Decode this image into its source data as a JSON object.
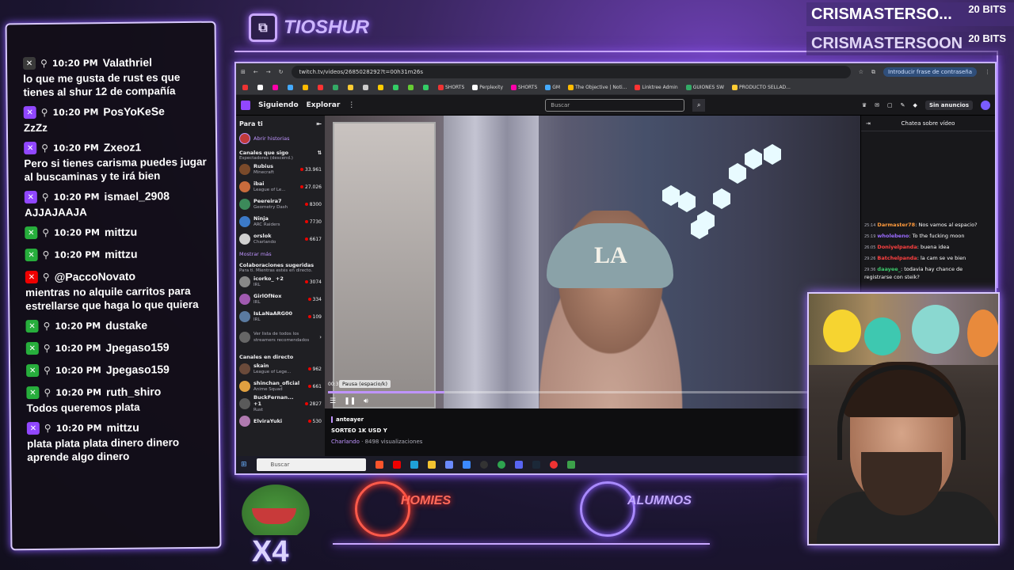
{
  "overlay_chat": {
    "messages": [
      {
        "time": "10:20 PM",
        "user": "Valathriel",
        "text": "lo que me gusta de rust es que tienes al shur 12 de compañía",
        "badge_color": "#3a3a3a",
        "name_color": "#ffffff"
      },
      {
        "time": "10:20 PM",
        "user": "PosYoKeSe",
        "text": "ZzZz",
        "badge_color": "#9147ff",
        "name_color": "#ffffff"
      },
      {
        "time": "10:20 PM",
        "user": "Zxeoz1",
        "text": "Pero si tienes carisma puedes jugar al buscaminas y te irá bien",
        "badge_color": "#9147ff",
        "name_color": "#ffffff"
      },
      {
        "time": "10:20 PM",
        "user": "ismael_2908",
        "text": "AJJAJAAJA",
        "badge_color": "#9147ff",
        "name_color": "#ffffff"
      },
      {
        "time": "10:20 PM",
        "user": "mittzu",
        "text": "",
        "badge_color": "#27ae3c",
        "name_color": "#ffffff"
      },
      {
        "time": "10:20 PM",
        "user": "mittzu",
        "text": "",
        "badge_color": "#27ae3c",
        "name_color": "#ffffff"
      },
      {
        "time": "",
        "user": "@PaccoNovato",
        "text": "mientras no alquile carritos para estrellarse que haga lo que quiera",
        "badge_color": "#e00",
        "name_color": "#ffffff"
      },
      {
        "time": "10:20 PM",
        "user": "dustake",
        "text": "",
        "badge_color": "#27ae3c",
        "name_color": "#ffffff"
      },
      {
        "time": "10:20 PM",
        "user": "Jpegaso159",
        "text": "",
        "badge_color": "#27ae3c",
        "name_color": "#ffffff"
      },
      {
        "time": "10:20 PM",
        "user": "Jpegaso159",
        "text": "",
        "badge_color": "#27ae3c",
        "name_color": "#ffffff"
      },
      {
        "time": "10:20 PM",
        "user": "ruth_shiro",
        "text": "Todos queremos plata",
        "badge_color": "#27ae3c",
        "name_color": "#ffffff"
      },
      {
        "time": "10:20 PM",
        "user": "mittzu",
        "text": "plata plata plata dinero dinero aprende algo dinero",
        "badge_color": "#9147ff",
        "name_color": "#ffffff"
      }
    ]
  },
  "bits": [
    {
      "name": "CRISMASTERSO...",
      "amount": "20 BITS"
    },
    {
      "name": "CRISMASTERSOON",
      "amount": "20 BITS"
    }
  ],
  "logo": {
    "text": "TIOSHUR"
  },
  "browser": {
    "url": "twitch.tv/videos/2685028292?t=00h31m26s",
    "password_chip": "Introducir frase de contraseña",
    "bookmarks": [
      "SHORTS",
      "Perplexity",
      "SHORTS",
      "GM",
      "The Objective | Noti...",
      "Linktree Admin",
      "GUIONES SW",
      "PRODUCTO SELLAD..."
    ]
  },
  "twitch": {
    "nav": {
      "following": "Siguiendo",
      "browse": "Explorar",
      "search_placeholder": "Buscar",
      "no_ads": "Sin anuncios"
    },
    "sidebar": {
      "title": "Para ti",
      "stories": "Abrir historias",
      "followed_header": "Canales que sigo",
      "followed_sub": "Espectadores (descend.)",
      "followed": [
        {
          "name": "Rubius",
          "game": "Minecraft",
          "viewers": "33.961",
          "color": "#7a4a2a"
        },
        {
          "name": "ibai",
          "game": "League of Le...",
          "viewers": "27.026",
          "color": "#c86b3c"
        },
        {
          "name": "Peereira7",
          "game": "Geometry Dash",
          "viewers": "8300",
          "color": "#3c8a5a"
        },
        {
          "name": "Ninja",
          "game": "ARC Raiders",
          "viewers": "7730",
          "color": "#3c7ac8"
        },
        {
          "name": "orslok",
          "game": "Charlando",
          "viewers": "6617",
          "color": "#d0d0d0"
        }
      ],
      "show_more": "Mostrar más",
      "collab_header": "Colaboraciones sugeridas",
      "collab_sub": "Para ti. Mientras estés en directo.",
      "collab": [
        {
          "name": "icorko_ +2",
          "game": "IRL",
          "viewers": "3074",
          "color": "#888"
        },
        {
          "name": "GirlOfNox",
          "game": "IRL",
          "viewers": "334",
          "color": "#a05ab0"
        },
        {
          "name": "IsLaNaARG00",
          "game": "IRL",
          "viewers": "109",
          "color": "#5a7aa0"
        }
      ],
      "see_all": "Ver lista de todos los streamers recomendados",
      "live_header": "Canales en directo",
      "live": [
        {
          "name": "skain",
          "game": "League of Lege...",
          "viewers": "962",
          "color": "#6a4a3a"
        },
        {
          "name": "shinchan_oficial",
          "game": "Anime Squad",
          "viewers": "661",
          "color": "#e0a040"
        },
        {
          "name": "BuckFernan... +1",
          "game": "Rust",
          "viewers": "2827",
          "color": "#5a5a5a"
        },
        {
          "name": "ElviraYuki",
          "game": "",
          "viewers": "530",
          "color": "#b07ab0"
        }
      ]
    },
    "player": {
      "tooltip": "Pausa (espacio/k)",
      "time": "00:3",
      "progress": 0.22
    },
    "info": {
      "channel": "anteayer",
      "title": "SORTEO 1K USD Y",
      "category": "Charlando",
      "views": "· 8498 visualizaciones"
    },
    "chat": {
      "header": "Chatea sobre vídeo",
      "lines": [
        {
          "t": "25:14",
          "user": "Darmaster78",
          "color": "#ff9a3c",
          "msg": "Nos vamos al espacio?"
        },
        {
          "t": "25:19",
          "user": "wholebeno",
          "color": "#9b6bff",
          "msg": "To the fucking moon"
        },
        {
          "t": "26:05",
          "user": "Doniyelpanda",
          "color": "#ff4040",
          "msg": "buena idea"
        },
        {
          "t": "29:26",
          "user": "Batchelpanda",
          "color": "#ff4040",
          "msg": "la cam se ve bien"
        },
        {
          "t": "29:36",
          "user": "daayee_",
          "color": "#3cc86b",
          "msg": "todavia hay chance de registrarse con steik?"
        }
      ]
    }
  },
  "taskbar": {
    "search_placeholder": "Buscar"
  },
  "bottom": {
    "x4": "X4",
    "homies": "HOMIES",
    "alumnos": "ALUMNOS"
  }
}
